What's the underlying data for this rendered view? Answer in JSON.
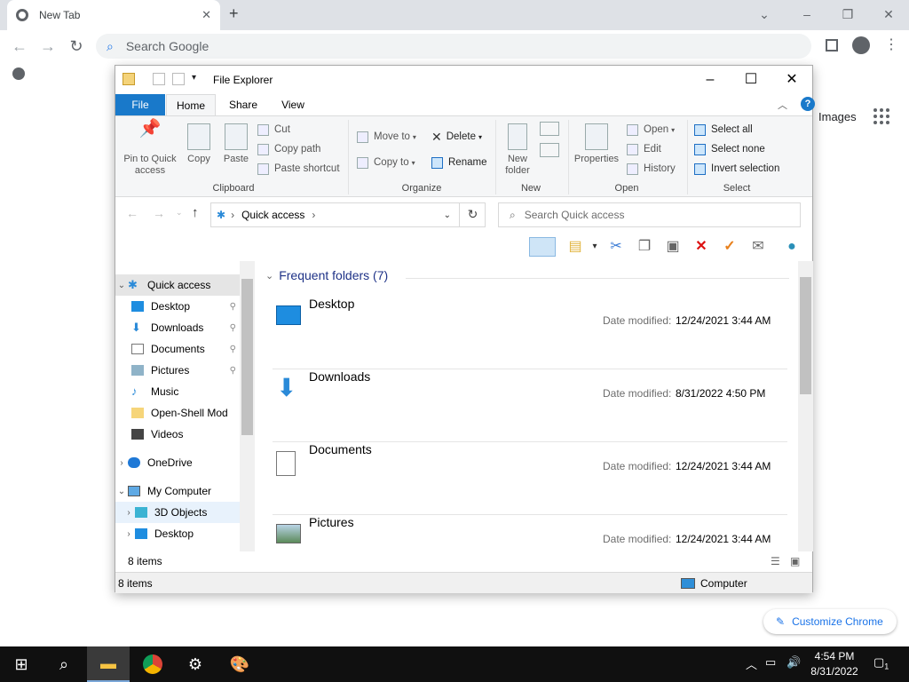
{
  "chrome": {
    "tab_title": "New Tab",
    "omnibox_placeholder": "Search Google",
    "images_link": "Images",
    "customize_label": "Customize Chrome"
  },
  "explorer": {
    "title": "File Explorer",
    "tabs": {
      "file": "File",
      "home": "Home",
      "share": "Share",
      "view": "View"
    },
    "ribbon": {
      "pin_to_quick_access": "Pin to Quick access",
      "copy": "Copy",
      "paste": "Paste",
      "cut": "Cut",
      "copy_path": "Copy path",
      "paste_shortcut": "Paste shortcut",
      "move_to": "Move to",
      "copy_to": "Copy to",
      "delete": "Delete",
      "rename": "Rename",
      "new_folder": "New folder",
      "properties": "Properties",
      "open": "Open",
      "edit": "Edit",
      "history": "History",
      "select_all": "Select all",
      "select_none": "Select none",
      "invert_selection": "Invert selection",
      "groups": {
        "clipboard": "Clipboard",
        "organize": "Organize",
        "new": "New",
        "open": "Open",
        "select": "Select"
      }
    },
    "address": "Quick access",
    "search_placeholder": "Search Quick access",
    "nav": {
      "quick_access": "Quick access",
      "items": [
        "Desktop",
        "Downloads",
        "Documents",
        "Pictures",
        "Music",
        "Open-Shell Mod",
        "Videos"
      ],
      "onedrive": "OneDrive",
      "my_computer": "My Computer",
      "objects3d": "3D Objects",
      "desktop2": "Desktop"
    },
    "frequent_header": "Frequent folders (7)",
    "date_label": "Date modified:",
    "folders": [
      {
        "name": "Desktop",
        "date": "12/24/2021 3:44 AM"
      },
      {
        "name": "Downloads",
        "date": "8/31/2022 4:50 PM"
      },
      {
        "name": "Documents",
        "date": "12/24/2021 3:44 AM"
      },
      {
        "name": "Pictures",
        "date": "12/24/2021 3:44 AM"
      }
    ],
    "item_count": "8 items",
    "status_items": "8 items",
    "status_location": "Computer"
  },
  "taskbar": {
    "time": "4:54 PM",
    "date": "8/31/2022",
    "notification_count": "1"
  }
}
